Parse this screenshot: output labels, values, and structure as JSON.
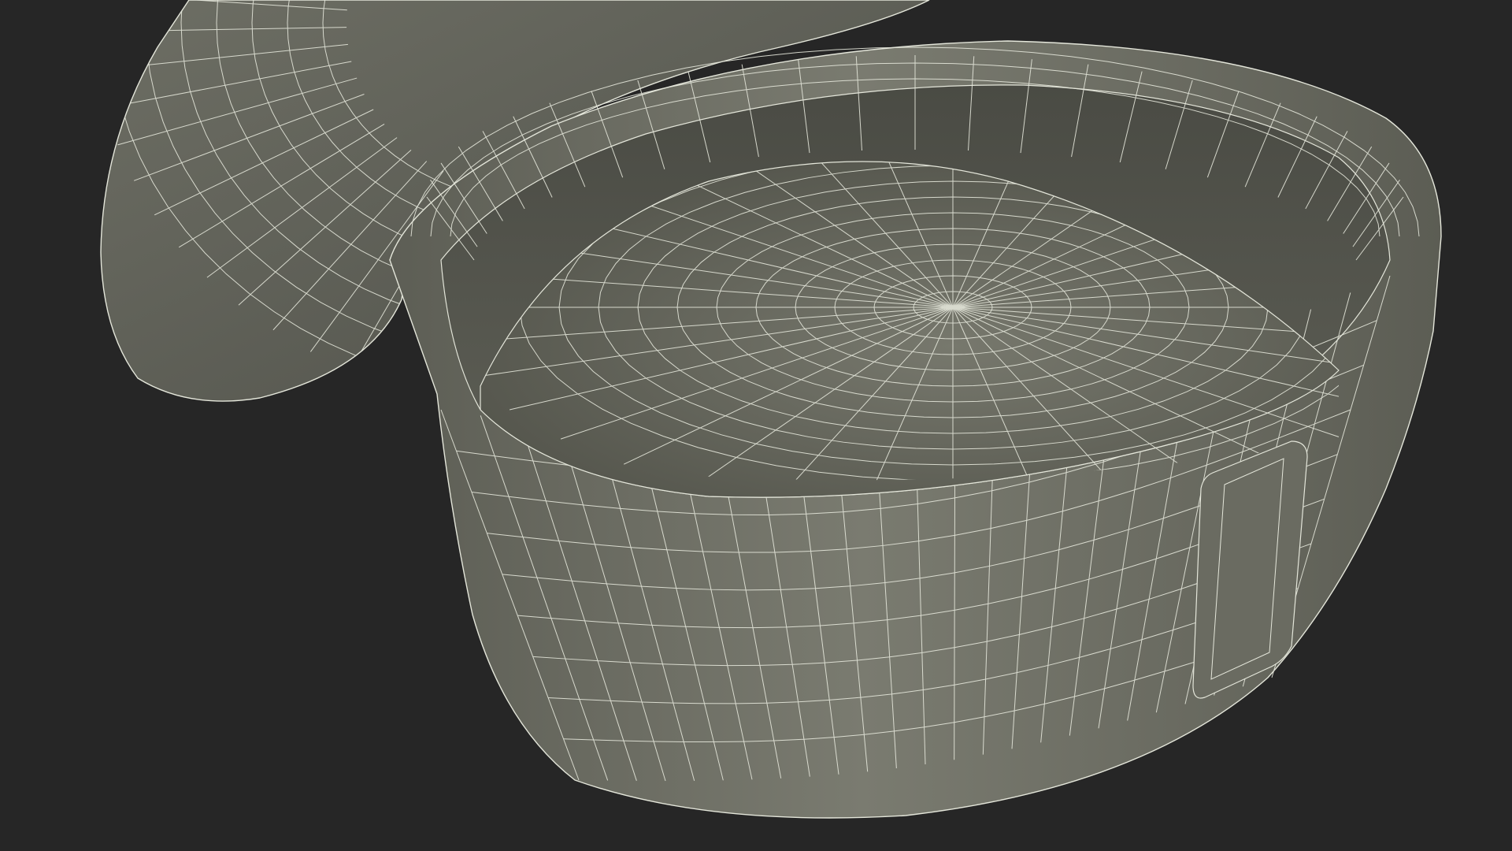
{
  "scene": {
    "description_visible_text": "",
    "background_color": "#262626",
    "surface_color": "#77786d",
    "surface_dark_color": "#5a5b52",
    "surface_shadow_color": "#45463f",
    "wire_color": "#e4e6da",
    "objects": [
      {
        "name": "lid"
      },
      {
        "name": "container-body"
      },
      {
        "name": "filling-dome"
      },
      {
        "name": "side-label-tab"
      }
    ]
  }
}
